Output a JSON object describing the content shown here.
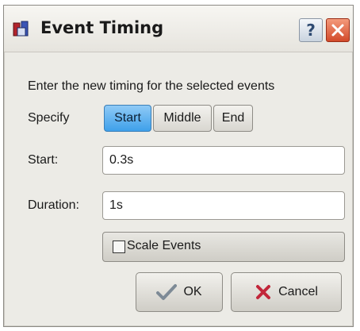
{
  "window": {
    "title": "Event Timing"
  },
  "titlebar": {
    "help_label": "?",
    "close_icon": "close-icon",
    "app_icon": "film-app-icon"
  },
  "dialog": {
    "instruction": "Enter the new timing for the selected events",
    "specify_label": "Specify",
    "specify_options": [
      "Start",
      "Middle",
      "End"
    ],
    "specify_selected": "Start",
    "start_label": "Start:",
    "start_value": "0.3s",
    "duration_label": "Duration:",
    "duration_value": "1s",
    "scale_events_label": "Scale Events",
    "scale_events_checked": false,
    "ok_label": "OK",
    "cancel_label": "Cancel"
  },
  "colors": {
    "accent_selected": "#3ea0ea",
    "close_button": "#d24a2a"
  }
}
